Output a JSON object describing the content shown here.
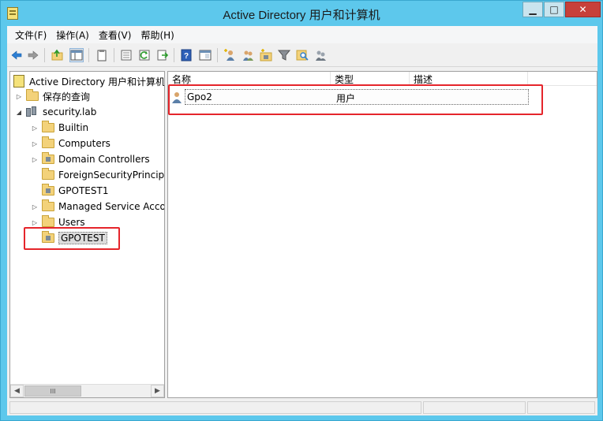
{
  "window": {
    "title": "Active Directory 用户和计算机",
    "controls": {
      "minimize": "▁",
      "maximize": "□",
      "close": "✕"
    }
  },
  "menu": {
    "items": [
      {
        "label": "文件(F)"
      },
      {
        "label": "操作(A)"
      },
      {
        "label": "查看(V)"
      },
      {
        "label": "帮助(H)"
      }
    ]
  },
  "toolbar": {
    "icons": [
      "back-icon",
      "forward-icon",
      "up-folder-icon",
      "show-tree-icon",
      "copy-icon",
      "properties-icon",
      "refresh-icon",
      "export-icon",
      "help-icon",
      "show-console-icon",
      "new-user-icon",
      "new-group-icon",
      "new-ou-icon",
      "filter-icon",
      "find-icon",
      "add-to-group-icon"
    ]
  },
  "tree": {
    "root": "Active Directory 用户和计算机",
    "saved_queries": "保存的查询",
    "domain": "security.lab",
    "children": [
      {
        "label": "Builtin",
        "expandable": true,
        "type": "folder"
      },
      {
        "label": "Computers",
        "expandable": true,
        "type": "folder"
      },
      {
        "label": "Domain Controllers",
        "expandable": true,
        "type": "ou"
      },
      {
        "label": "ForeignSecurityPrincipa",
        "expandable": false,
        "type": "folder"
      },
      {
        "label": "GPOTEST1",
        "expandable": false,
        "type": "ou"
      },
      {
        "label": "Managed Service Acco",
        "expandable": true,
        "type": "folder"
      },
      {
        "label": "Users",
        "expandable": true,
        "type": "folder"
      },
      {
        "label": "GPOTEST",
        "expandable": false,
        "type": "ou",
        "selected": true
      }
    ],
    "scroll_thumb": "III"
  },
  "list": {
    "columns": [
      "名称",
      "类型",
      "描述"
    ],
    "rows": [
      {
        "name": "Gpo2",
        "type": "用户",
        "description": ""
      }
    ]
  },
  "colors": {
    "title_bar": "#5dc8ec",
    "annotation": "#e5252b"
  }
}
